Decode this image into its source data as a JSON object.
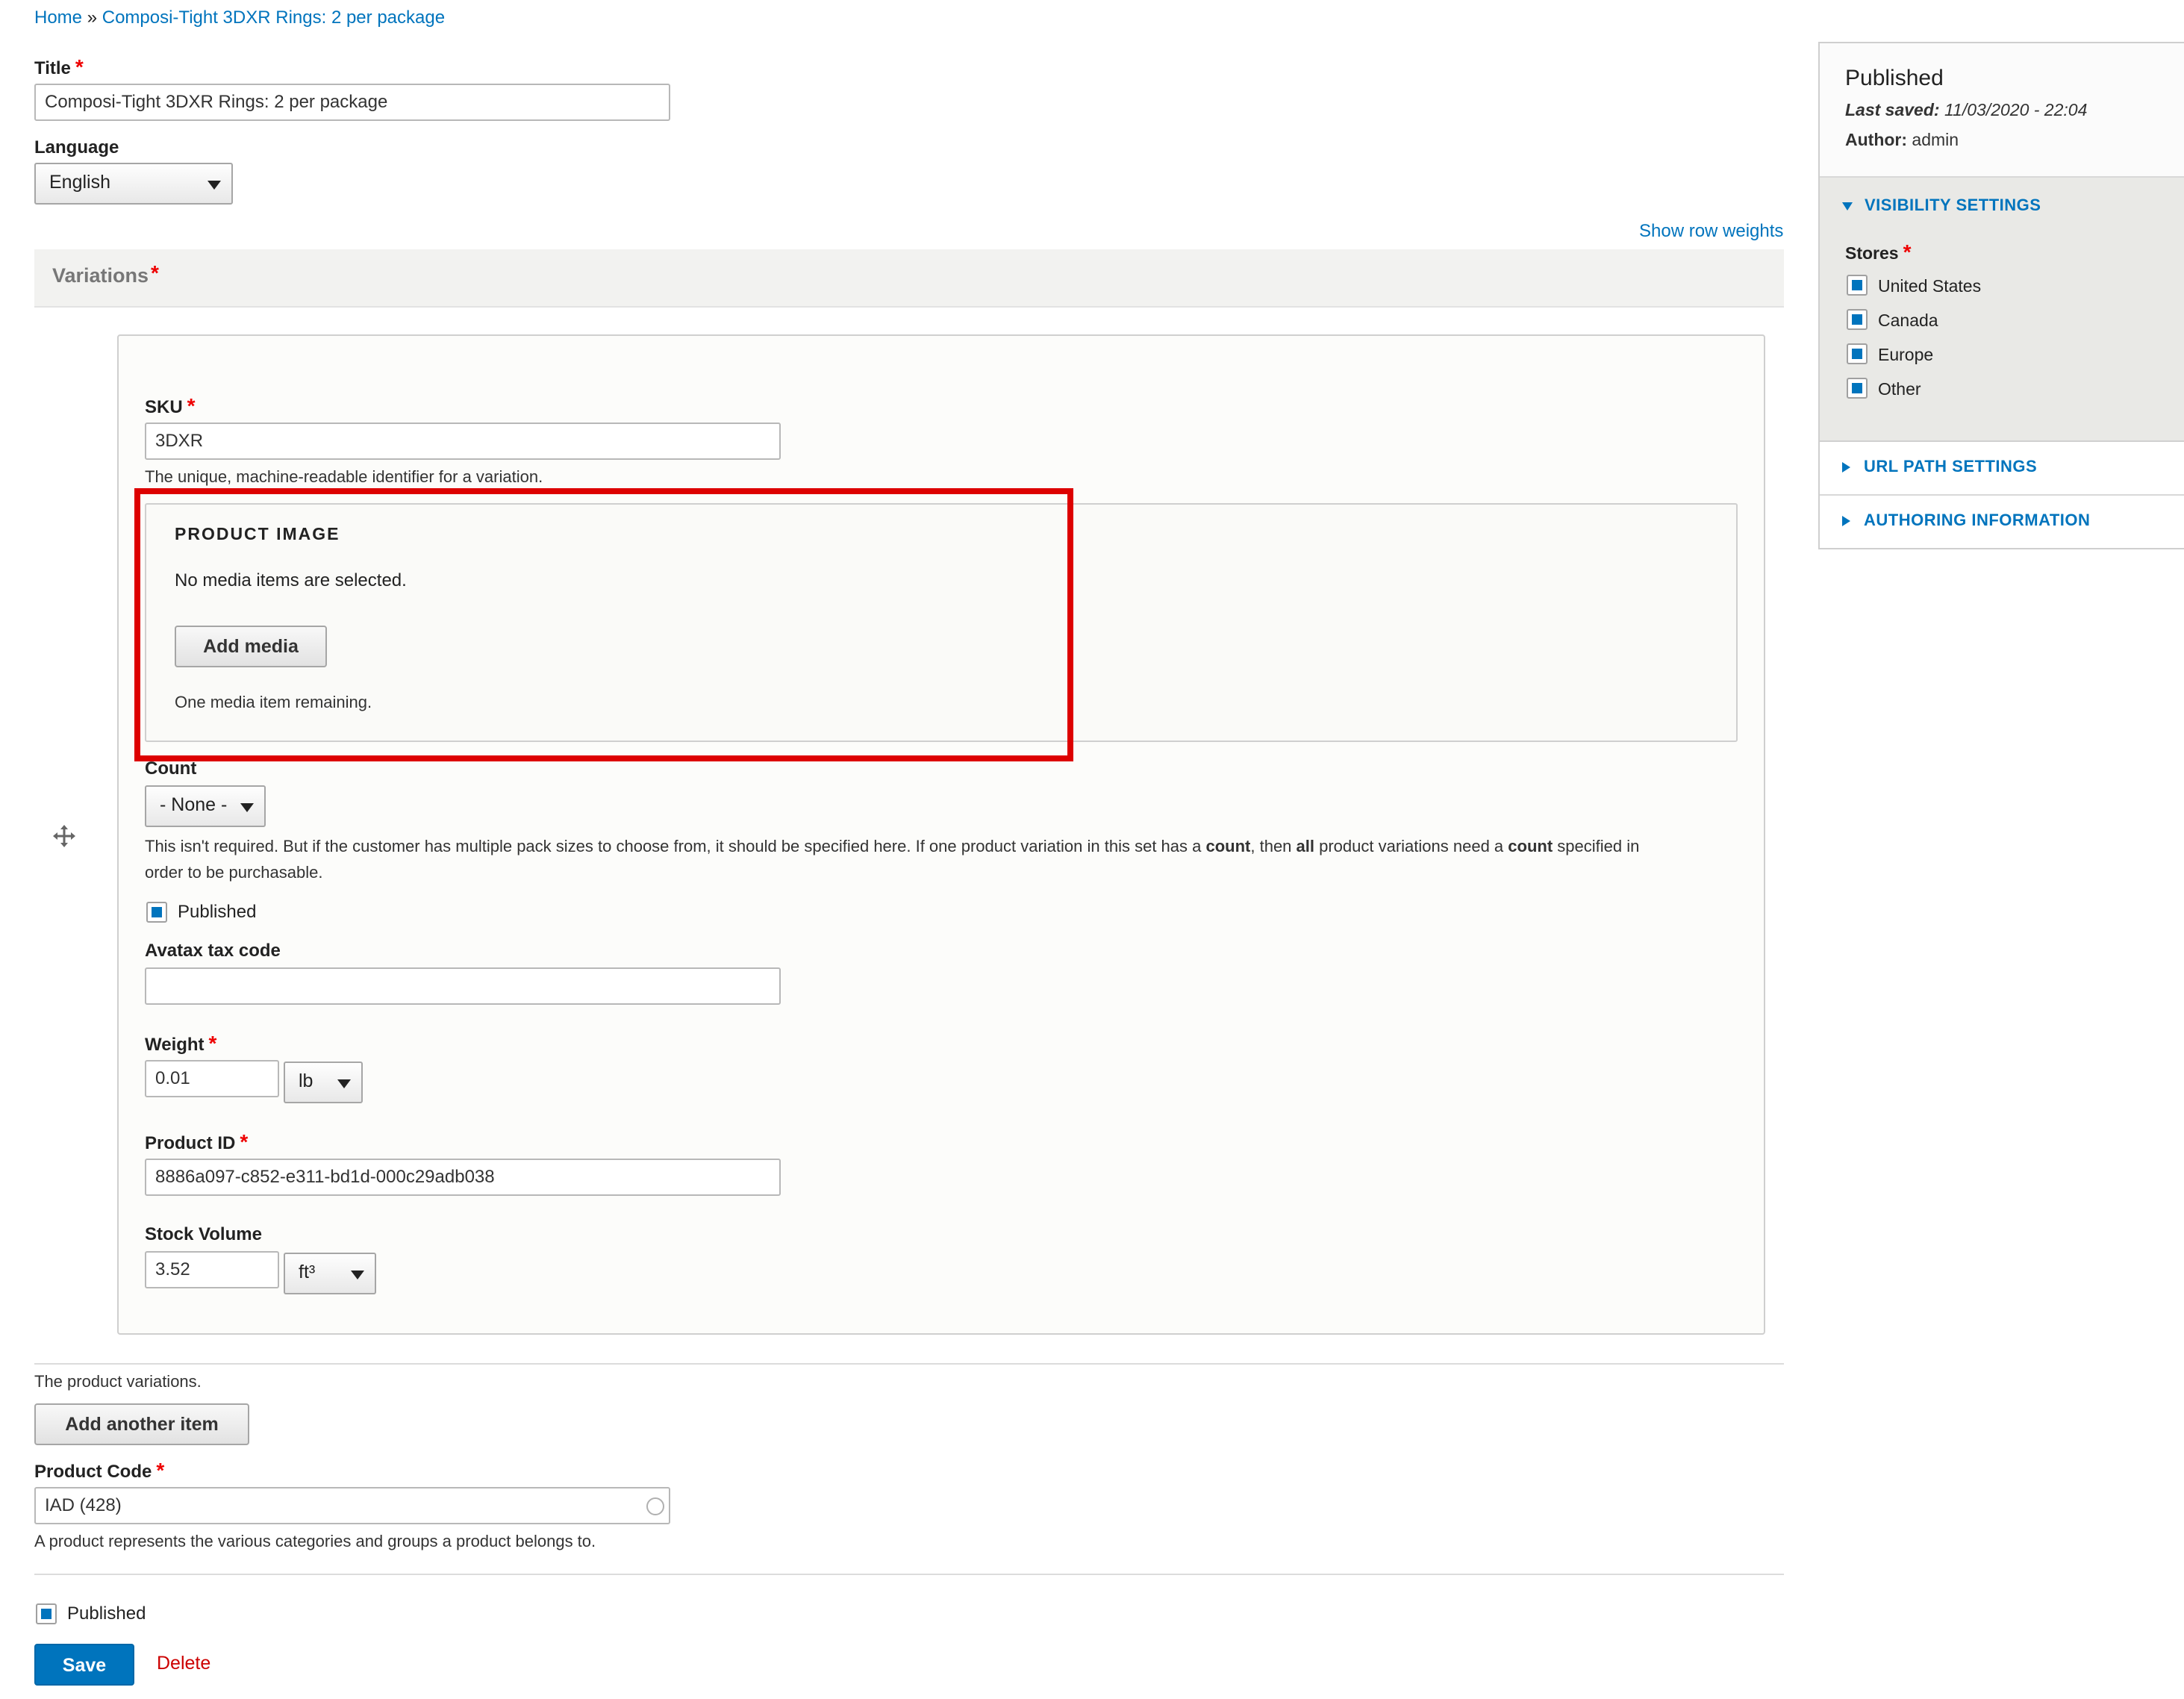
{
  "breadcrumb": {
    "home": "Home",
    "separator": "»",
    "current": "Composi-Tight 3DXR Rings: 2 per package"
  },
  "title_field": {
    "label": "Title",
    "value": "Composi-Tight 3DXR Rings: 2 per package"
  },
  "language_field": {
    "label": "Language",
    "selected": "English"
  },
  "show_row_weights": "Show row weights",
  "variations": {
    "heading": "Variations",
    "sku": {
      "label": "SKU",
      "value": "3DXR",
      "description": "The unique, machine-readable identifier for a variation."
    },
    "product_image": {
      "legend": "PRODUCT IMAGE",
      "empty_text": "No media items are selected.",
      "add_button": "Add media",
      "remaining": "One media item remaining."
    },
    "count": {
      "label": "Count",
      "selected": "- None -",
      "description_part1": "This isn't required. But if the customer has multiple pack sizes to choose from, it should be specified here.  If one product variation in this set has a ",
      "bold1": "count",
      "description_part2": ", then ",
      "bold2": "all",
      "description_part3": " product variations need a ",
      "bold3": "count",
      "description_part4": " specified in",
      "description_line2": "order to be purchasable."
    },
    "published_label": "Published",
    "avatax": {
      "label": "Avatax tax code",
      "value": ""
    },
    "weight": {
      "label": "Weight",
      "value": "0.01",
      "unit": "lb"
    },
    "product_id": {
      "label": "Product ID",
      "value": "8886a097-c852-e311-bd1d-000c29adb038"
    },
    "stock_volume": {
      "label": "Stock Volume",
      "value": "3.52",
      "unit": "ft³"
    },
    "footer_description": "The product variations.",
    "add_another": "Add another item"
  },
  "product_code": {
    "label": "Product Code",
    "value": "IAD (428)",
    "description": "A product represents the various categories and groups a product belongs to."
  },
  "bottom": {
    "published_label": "Published",
    "save": "Save",
    "delete": "Delete"
  },
  "sidebar": {
    "status": "Published",
    "last_saved_label": "Last saved:",
    "last_saved_value": "11/03/2020 - 22:04",
    "author_label": "Author:",
    "author_value": "admin",
    "visibility": {
      "title": "VISIBILITY SETTINGS",
      "stores_label": "Stores",
      "stores": [
        "United States",
        "Canada",
        "Europe",
        "Other"
      ]
    },
    "url_path": "URL PATH SETTINGS",
    "authoring": "AUTHORING INFORMATION"
  },
  "colors": {
    "link": "#0074bd",
    "required": "#e00000",
    "highlight": "#dd0000",
    "primary_button": "#0074bd",
    "delete": "#cc0000"
  }
}
